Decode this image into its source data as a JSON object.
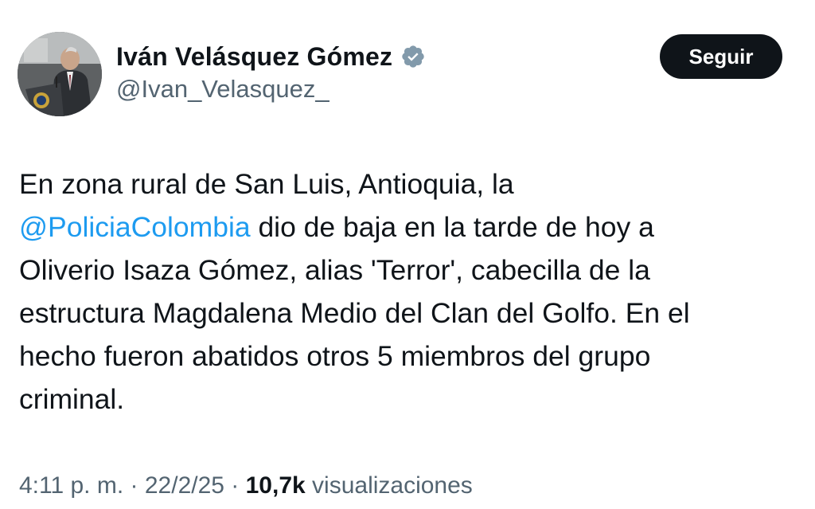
{
  "author": {
    "display_name": "Iván Velásquez Gómez",
    "handle": "@Ivan_Velasquez_",
    "verified": true
  },
  "follow_button": {
    "label": "Seguir"
  },
  "tweet": {
    "lines": [
      {
        "before": "En zona rural de San Luis, Antioquia, la",
        "mention": "",
        "after": ""
      },
      {
        "before": "",
        "mention": "@PoliciaColombia",
        "after": " dio de baja en la tarde de hoy a"
      },
      {
        "before": "Oliverio Isaza Gómez, alias 'Terror', cabecilla de la",
        "mention": "",
        "after": ""
      },
      {
        "before": "estructura Magdalena Medio del Clan del Golfo. En el",
        "mention": "",
        "after": ""
      },
      {
        "before": "hecho fueron abatidos otros 5 miembros del grupo",
        "mention": "",
        "after": ""
      },
      {
        "before": "criminal.",
        "mention": "",
        "after": ""
      }
    ]
  },
  "meta": {
    "time": "4:11 p. m.",
    "separator": " · ",
    "date": "22/2/25",
    "views_count": "10,7k",
    "views_label": " visualizaciones"
  },
  "colors": {
    "text": "#0f1419",
    "secondary": "#536471",
    "link": "#1d9bf0",
    "verified_badge": "#829aab",
    "button_bg": "#0f1419",
    "button_text": "#ffffff"
  },
  "icons": {
    "verified": "verified-badge-icon",
    "avatar": "profile-photo"
  }
}
